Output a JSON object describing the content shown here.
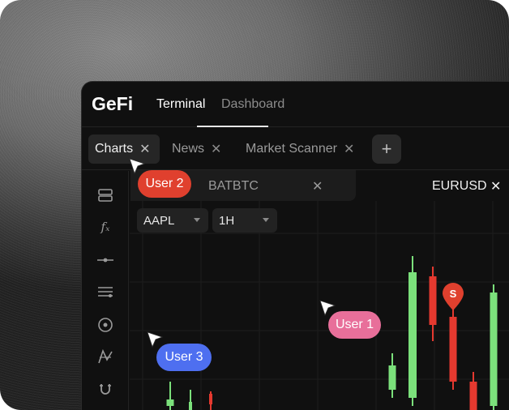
{
  "app": {
    "logo": "GeFi"
  },
  "topnav": [
    {
      "label": "Terminal",
      "active": true
    },
    {
      "label": "Dashboard",
      "active": false
    }
  ],
  "tabs": [
    {
      "label": "Charts",
      "active": true
    },
    {
      "label": "News",
      "active": false
    },
    {
      "label": "Market Scanner",
      "active": false
    }
  ],
  "close_glyph": "✕",
  "add_tab_glyph": "+",
  "sidebar_tools": [
    "layers-icon",
    "function-icon",
    "horizontal-line-icon",
    "list-lines-icon",
    "target-icon",
    "pattern-icon",
    "magnet-icon"
  ],
  "sidebar_fx_glyph": "𝑓ₓ",
  "subtabs": {
    "secondary": "BATBTC"
  },
  "symbol_tab": "EURUSD",
  "controls": {
    "symbol": "AAPL",
    "interval": "1H"
  },
  "marker": {
    "label": "S",
    "color": "#e0402e"
  },
  "users": [
    {
      "name": "User 2",
      "color": "#e0402e"
    },
    {
      "name": "User 1",
      "color": "#e86f9a"
    },
    {
      "name": "User 3",
      "color": "#4e6ff0"
    }
  ],
  "colors": {
    "bull": "#7be07b",
    "bear": "#e5392f",
    "grid": "#1e1e1e"
  },
  "chart_data": {
    "type": "candlestick",
    "candles": [
      {
        "dir": "up",
        "open": 20,
        "close": 28,
        "high": 50,
        "low": 10
      },
      {
        "dir": "up",
        "open": 12,
        "close": 25,
        "high": 40,
        "low": 5
      },
      {
        "dir": "down",
        "open": 35,
        "close": 22,
        "high": 38,
        "low": 8
      },
      {
        "dir": "up",
        "open": 40,
        "close": 70,
        "high": 85,
        "low": 30
      },
      {
        "dir": "up",
        "open": 30,
        "close": 185,
        "high": 205,
        "low": 20
      },
      {
        "dir": "down",
        "open": 180,
        "close": 120,
        "high": 192,
        "low": 100
      },
      {
        "dir": "down",
        "open": 130,
        "close": 50,
        "high": 140,
        "low": 40
      },
      {
        "dir": "down",
        "open": 50,
        "close": 15,
        "high": 62,
        "low": 5
      },
      {
        "dir": "up",
        "open": 20,
        "close": 160,
        "high": 170,
        "low": 10
      }
    ]
  }
}
